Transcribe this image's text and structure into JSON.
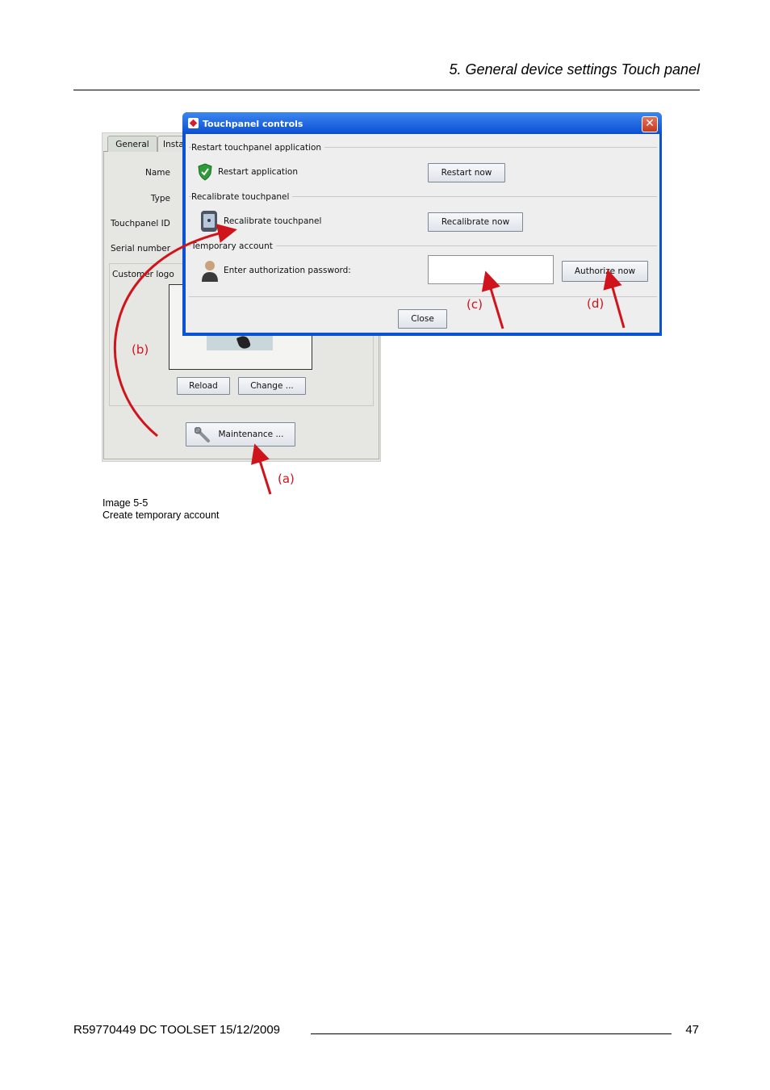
{
  "page_header": {
    "title": "5. General device settings Touch panel"
  },
  "figure": {
    "device_panel": {
      "tabs": [
        "General",
        "Insta"
      ],
      "fields": [
        "Name",
        "Type",
        "Touchpanel ID",
        "Serial number",
        "Customer logo"
      ],
      "buttons": {
        "reload": "Reload",
        "change": "Change ...",
        "maintenance": "Maintenance ..."
      }
    },
    "dialog": {
      "title": "Touchpanel controls",
      "sections": [
        {
          "header": "Restart touchpanel application",
          "row_label": "Restart application",
          "button": "Restart now"
        },
        {
          "header": "Recalibrate touchpanel",
          "row_label": "Recalibrate touchpanel",
          "button": "Recalibrate now"
        },
        {
          "header": "Temporary account",
          "row_label": "Enter authorization password:",
          "button": "Authorize now"
        }
      ],
      "close_button": "Close"
    },
    "annotations": {
      "a": "(a)",
      "b": "(b)",
      "c": "(c)",
      "d": "(d)",
      "color": "#d0141c"
    },
    "caption": {
      "number": "Image 5-5",
      "text": "Create temporary account"
    }
  },
  "page_footer": {
    "doc": "R59770449  DC TOOLSET  15/12/2009",
    "page_number": "47"
  }
}
